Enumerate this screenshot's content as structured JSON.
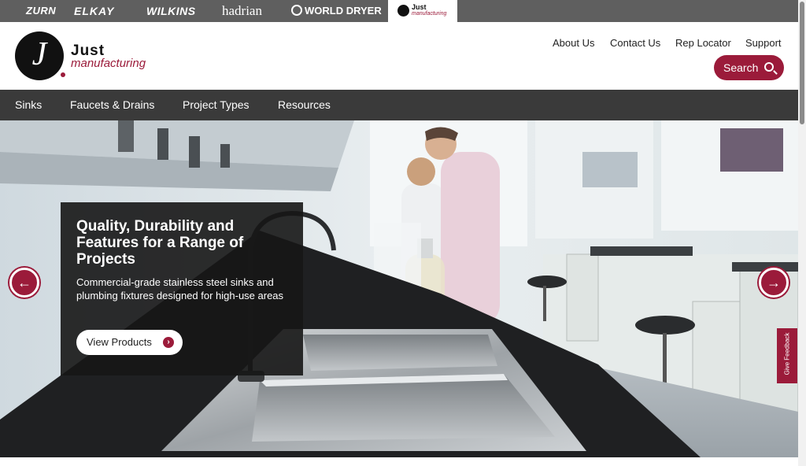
{
  "brand_bar": {
    "brands": [
      "ZURN",
      "ELKAY",
      "WILKINS",
      "hadrian",
      "WORLD DRYER"
    ],
    "active": {
      "just": "Just",
      "manufacturing": "manufacturing"
    }
  },
  "header": {
    "logo": {
      "just": "Just",
      "manufacturing": "manufacturing"
    },
    "util_links": [
      "About Us",
      "Contact Us",
      "Rep Locator",
      "Support"
    ],
    "search_label": "Search"
  },
  "main_nav": {
    "items": [
      "Sinks",
      "Faucets & Drains",
      "Project Types",
      "Resources"
    ]
  },
  "hero": {
    "title": "Quality, Durability and Features for a Range of Projects",
    "description": "Commercial-grade stainless steel sinks and plumbing fixtures designed for high-use areas",
    "cta_label": "View Products",
    "prev_icon": "arrow-left-icon",
    "next_icon": "arrow-right-icon"
  },
  "feedback": {
    "label": "Give Feedback"
  },
  "colors": {
    "accent": "#9b1b3a",
    "nav_bg": "#3a3a3a",
    "brand_bar_bg": "#5f5f5f"
  }
}
